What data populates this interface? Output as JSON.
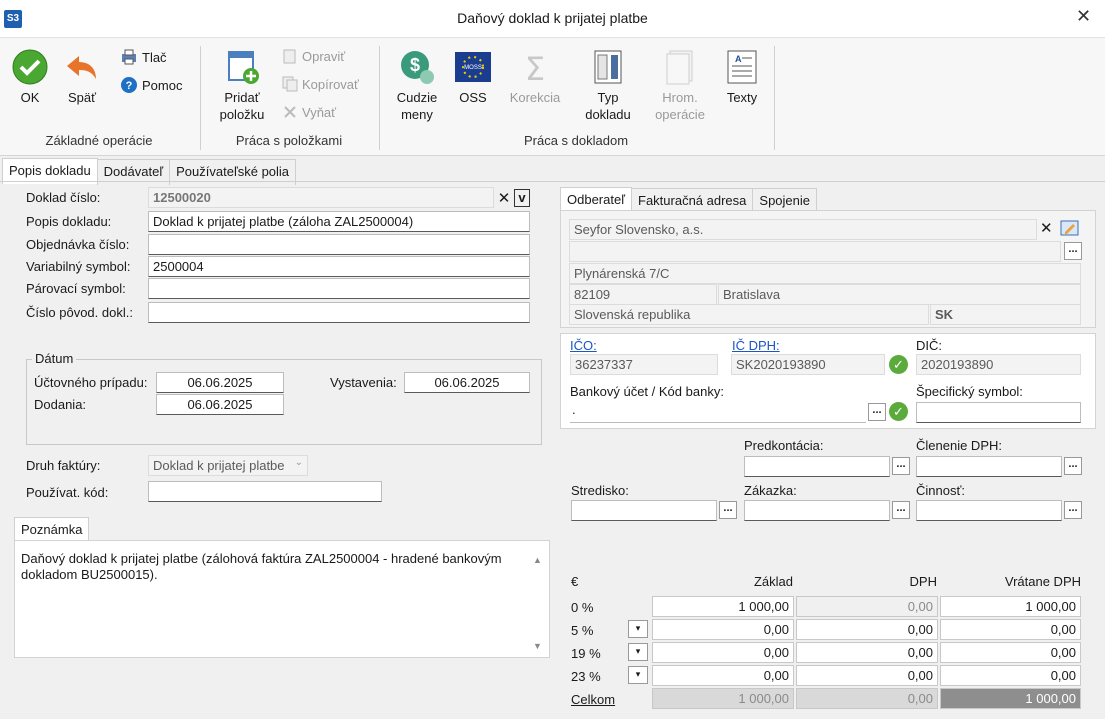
{
  "window": {
    "app_icon": "S3",
    "title": "Daňový doklad k prijatej platbe",
    "close": "✕"
  },
  "ribbon": {
    "ok": "OK",
    "spat": "Späť",
    "tlac": "Tlač",
    "pomoc": "Pomoc",
    "group1": "Základné operácie",
    "pridat": "Pridať\npoložku",
    "opravit": "Opraviť",
    "kopirovat": "Kopírovať",
    "vynat": "Vyňať",
    "group2": "Práca s položkami",
    "cudzie_meny": "Cudzie\nmeny",
    "oss": "OSS",
    "oss_badge": "MOSS",
    "korekcia": "Korekcia",
    "typ_dokladu": "Typ\ndokladu",
    "hrom_operacie": "Hrom.\noperácie",
    "texty": "Texty",
    "group3": "Práca s dokladom"
  },
  "tabs": [
    "Popis dokladu",
    "Dodávateľ",
    "Používateľské polia"
  ],
  "form": {
    "doklad_cislo_label": "Doklad číslo:",
    "doklad_cislo": "12500020",
    "popis_label": "Popis dokladu:",
    "popis": "Doklad k prijatej platbe (záloha ZAL2500004)",
    "objednavka_label": "Objednávka číslo:",
    "objednavka": "",
    "variabilny_label": "Variabilný symbol:",
    "variabilny": "2500004",
    "parovaci_label": "Párovací symbol:",
    "parovaci": "",
    "povod_label": "Číslo pôvod. dokl.:",
    "povod": "",
    "datum_group": "Dátum",
    "uctovny_label": "Účtovného prípadu:",
    "uctovny": "06.06.2025",
    "vystavenia_label": "Vystavenia:",
    "vystavenia": "06.06.2025",
    "dodania_label": "Dodania:",
    "dodania": "06.06.2025",
    "druh_label": "Druh faktúry:",
    "druh": "Doklad k prijatej platbe",
    "pouzivat_label": "Používat. kód:",
    "pouzivat": "",
    "poznamka_tab": "Poznámka",
    "poznamka": "Daňový doklad k prijatej platbe (zálohová faktúra ZAL2500004 - hradené bankovým dokladom BU2500015)."
  },
  "partner_tabs": [
    "Odberateľ",
    "Fakturačná adresa",
    "Spojenie"
  ],
  "partner": {
    "name": "Seyfor Slovensko, a.s.",
    "line2": "",
    "street": "Plynárenská 7/C",
    "zip": "82109",
    "city": "Bratislava",
    "country": "Slovenská republika",
    "country_code": "SK",
    "ico_label": "IČO:",
    "ico": "36237337",
    "icdph_label": "IČ DPH:",
    "icdph": "SK2020193890",
    "dic_label": "DIČ:",
    "dic": "2020193890",
    "bank_label": "Bankový účet / Kód banky:",
    "bank_value": ".",
    "specific_label": "Špecifický symbol:",
    "specific": ""
  },
  "accounting": {
    "predkontacia_label": "Predkontácia:",
    "clenenie_label": "Členenie DPH:",
    "stredisko_label": "Stredisko:",
    "zakazka_label": "Zákazka:",
    "cinnost_label": "Činnosť:"
  },
  "vat_table": {
    "headers": {
      "cur": "€",
      "base": "Základ",
      "vat": "DPH",
      "total": "Vrátane DPH"
    },
    "rows": [
      {
        "rate": "0 %",
        "base": "1 000,00",
        "vat": "0,00",
        "total": "1 000,00"
      },
      {
        "rate": "5 %",
        "base": "0,00",
        "vat": "0,00",
        "total": "0,00"
      },
      {
        "rate": "19 %",
        "base": "0,00",
        "vat": "0,00",
        "total": "0,00"
      },
      {
        "rate": "23 %",
        "base": "0,00",
        "vat": "0,00",
        "total": "0,00"
      }
    ],
    "sum": {
      "label": "Celkom",
      "base": "1 000,00",
      "vat": "0,00",
      "total": "1 000,00"
    }
  }
}
